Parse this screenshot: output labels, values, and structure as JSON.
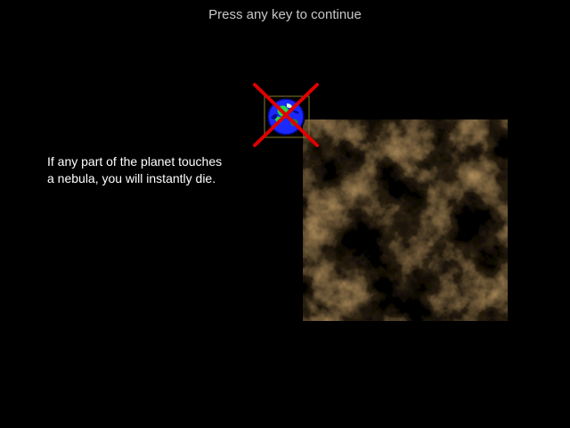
{
  "screen": {
    "prompt": "Press any key to continue",
    "instructions": [
      "If any part of the planet touches",
      "a nebula, you will instantly die."
    ]
  },
  "icons": {
    "planet": "planet-earth-icon",
    "forbidden_mark": "red-cross-icon"
  },
  "colors": {
    "background": "#000000",
    "prompt_text": "#c8c8c8",
    "instruction_text": "#ffffff",
    "cross": "#e00000",
    "planet_ocean": "#1a2aff",
    "planet_land": "#22dd44",
    "nebula_glow": "#ffd590"
  }
}
